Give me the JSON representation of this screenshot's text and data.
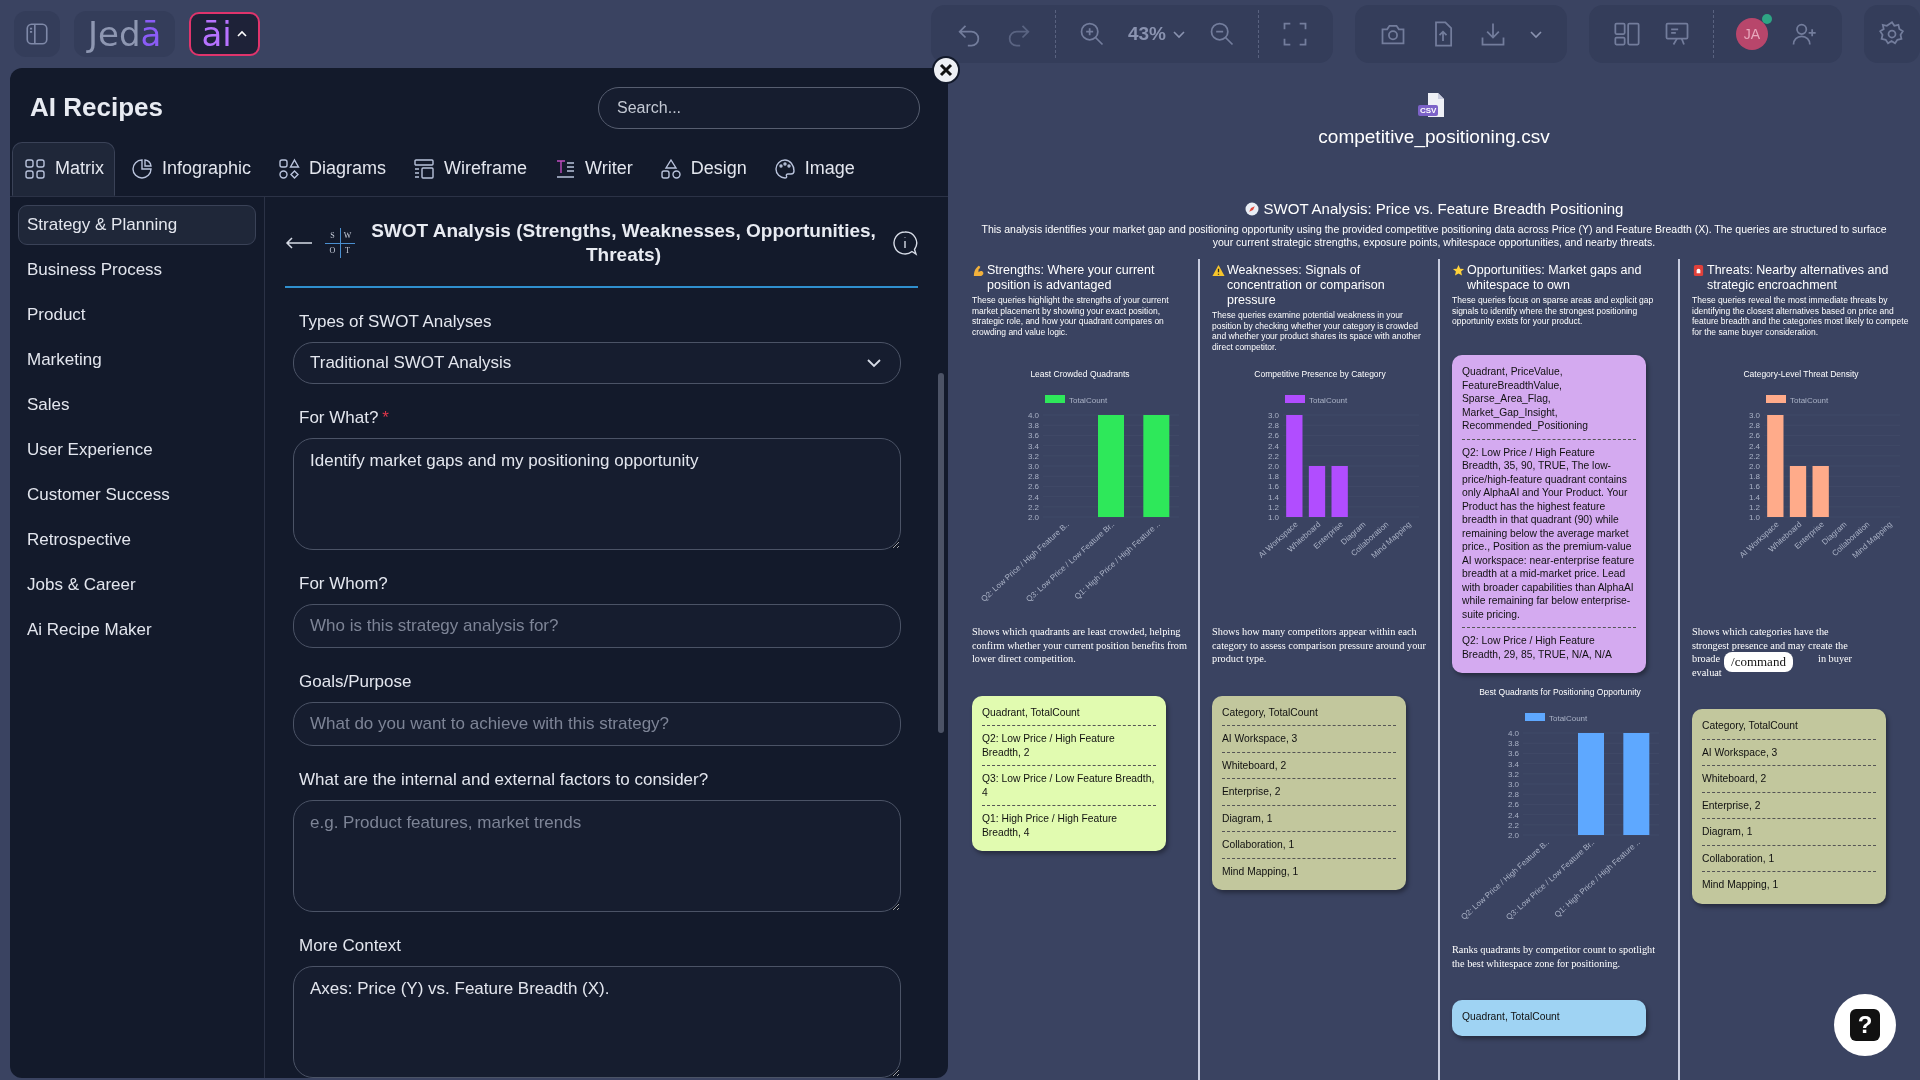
{
  "topbar": {
    "logo": "Jedā",
    "ai_button": {
      "label": "āi",
      "expanded": true
    }
  },
  "recipes_panel": {
    "title": "AI Recipes",
    "search": {
      "placeholder": "Search..."
    },
    "tabs": [
      {
        "label": "Matrix",
        "selected": true
      },
      {
        "label": "Infographic",
        "selected": false
      },
      {
        "label": "Diagrams",
        "selected": false
      },
      {
        "label": "Wireframe",
        "selected": false
      },
      {
        "label": "Writer",
        "selected": false
      },
      {
        "label": "Design",
        "selected": false
      },
      {
        "label": "Image",
        "selected": false
      }
    ],
    "categories": [
      {
        "label": "Strategy & Planning",
        "selected": true
      },
      {
        "label": "Business Process",
        "selected": false
      },
      {
        "label": "Product",
        "selected": false
      },
      {
        "label": "Marketing",
        "selected": false
      },
      {
        "label": "Sales",
        "selected": false
      },
      {
        "label": "User Experience",
        "selected": false
      },
      {
        "label": "Customer Success",
        "selected": false
      },
      {
        "label": "Retrospective",
        "selected": false
      },
      {
        "label": "Jobs & Career",
        "selected": false
      },
      {
        "label": "Ai Recipe Maker",
        "selected": false
      }
    ],
    "required_mark": "*",
    "recipe": {
      "title": "SWOT Analysis (Strengths, Weaknesses, Opportunities, Threats)",
      "icon_letters": [
        "S",
        "W",
        "O",
        "T"
      ]
    },
    "fields": [
      {
        "kind": "select",
        "label": "Types of SWOT Analyses",
        "required": false,
        "value": "Traditional SWOT Analysis"
      },
      {
        "kind": "textarea",
        "label": "For What?",
        "required": true,
        "value": "Identify market gaps and my positioning opportunity"
      },
      {
        "kind": "input",
        "label": "For Whom?",
        "required": false,
        "placeholder": "Who is this strategy analysis for?"
      },
      {
        "kind": "input",
        "label": "Goals/Purpose",
        "required": false,
        "placeholder": "What do you want to achieve with this strategy?"
      },
      {
        "kind": "textarea",
        "label": "What are the internal and external factors to consider?",
        "required": false,
        "placeholder": "e.g. Product features, market trends"
      },
      {
        "kind": "textarea",
        "label": "More Context",
        "required": false,
        "value": "Axes: Price (Y) vs. Feature Breadth (X)."
      }
    ]
  },
  "toolbar": {
    "zoom": "43%",
    "avatar": {
      "initials": "JA",
      "online": true
    }
  },
  "canvas": {
    "file_badge": "CSV",
    "file_name": "competitive_positioning.csv",
    "title": "SWOT Analysis: Price vs. Feature Breadth Positioning",
    "description": "This analysis identifies your market gap and positioning opportunity using the provided competitive positioning data across Price (Y) and Feature Breadth (X). The queries are structured to surface your current strategic strengths, exposure points, whitespace opportunities, and nearby threats.",
    "columns": [
      {
        "kind": "strengths",
        "heading": "Strengths: Where your current position is advantaged",
        "description": "These queries highlight the strengths of your current market placement by showing your exact position, strategic role, and how your quadrant compares on crowding and value logic.",
        "blocks": [
          {
            "kind": "chart",
            "chart_data": {
              "type": "bar",
              "title": "Least Crowded Quadrants",
              "categories": [
                "Q2: Low Price / High Feature B..",
                "Q3: Low Price / Low Feature Br..",
                "Q1: High Price / High Feature .."
              ],
              "series": [
                {
                  "name": "TotalCount",
                  "color": "#2ee85a",
                  "values": [
                    2,
                    4,
                    4
                  ]
                }
              ],
              "ylim": [
                2,
                4
              ],
              "yticks": [
                {
                  "value": 2,
                  "label": "2.0"
                },
                {
                  "value": 2.2,
                  "label": "2.2"
                },
                {
                  "value": 2.4,
                  "label": "2.4"
                },
                {
                  "value": 2.6,
                  "label": "2.6"
                },
                {
                  "value": 2.8,
                  "label": "2.8"
                },
                {
                  "value": 3,
                  "label": "3.0"
                },
                {
                  "value": 3.2,
                  "label": "3.2"
                },
                {
                  "value": 3.4,
                  "label": "3.4"
                },
                {
                  "value": 3.6,
                  "label": "3.6"
                },
                {
                  "value": 3.8,
                  "label": "3.8"
                },
                {
                  "value": 4,
                  "label": "4.0"
                }
              ]
            }
          },
          {
            "kind": "caption",
            "text": "Shows which quadrants are least crowded, helping confirm whether your current position benefits from lower direct competition."
          },
          {
            "kind": "note",
            "color": "#e1fbb0",
            "entries": [
              "Quadrant, TotalCount",
              "Q2: Low Price / High Feature Breadth, 2",
              "Q3: Low Price / Low Feature Breadth, 4",
              "Q1: High Price / High Feature Breadth, 4"
            ]
          }
        ]
      },
      {
        "kind": "weaknesses",
        "heading": "Weaknesses: Signals of concentration or comparison pressure",
        "description": "These queries examine potential weakness in your position by checking whether your category is crowded and whether your product shares its space with another direct competitor.",
        "blocks": [
          {
            "kind": "chart",
            "chart_data": {
              "type": "bar",
              "title": "Competitive Presence by Category",
              "categories": [
                "AI Workspace",
                "Whiteboard",
                "Enterprise",
                "Diagram",
                "Collaboration",
                "Mind Mapping"
              ],
              "series": [
                {
                  "name": "TotalCount",
                  "color": "#b14dff",
                  "values": [
                    3,
                    2,
                    2,
                    1,
                    1,
                    1
                  ]
                }
              ],
              "ylim": [
                1,
                3
              ],
              "yticks": [
                {
                  "value": 1,
                  "label": "1.0"
                },
                {
                  "value": 1.2,
                  "label": "1.2"
                },
                {
                  "value": 1.4,
                  "label": "1.4"
                },
                {
                  "value": 1.6,
                  "label": "1.6"
                },
                {
                  "value": 1.8,
                  "label": "1.8"
                },
                {
                  "value": 2,
                  "label": "2.0"
                },
                {
                  "value": 2.2,
                  "label": "2.2"
                },
                {
                  "value": 2.4,
                  "label": "2.4"
                },
                {
                  "value": 2.6,
                  "label": "2.6"
                },
                {
                  "value": 2.8,
                  "label": "2.8"
                },
                {
                  "value": 3,
                  "label": "3.0"
                }
              ]
            }
          },
          {
            "kind": "caption",
            "text": "Shows how many competitors appear within each category to assess comparison pressure around your product type."
          },
          {
            "kind": "note",
            "color": "#c2c79d",
            "entries": [
              "Category, TotalCount",
              "AI Workspace, 3",
              "Whiteboard, 2",
              "Enterprise, 2",
              "Diagram, 1",
              "Collaboration, 1",
              "Mind Mapping, 1"
            ]
          }
        ]
      },
      {
        "kind": "opportunities",
        "heading": "Opportunities: Market gaps and whitespace to own",
        "description": "These queries focus on sparse areas and explicit gap signals to identify where the strongest positioning opportunity exists for your product.",
        "blocks": [
          {
            "kind": "note",
            "color": "#d4aaf0",
            "entries": [
              "Quadrant, PriceValue, FeatureBreadthValue, Sparse_Area_Flag, Market_Gap_Insight, Recommended_Positioning",
              "Q2: Low Price / High Feature Breadth, 35, 90, TRUE, The low-price/high-feature quadrant contains only AlphaAI and Your Product. Your Product has the highest feature breadth in that quadrant (90) while remaining below the average market price., Position as the premium-value AI workspace: near-enterprise feature breadth at a mid-market price. Lead with broader capabilities than AlphaAI while remaining far below enterprise-suite pricing.",
              "Q2: Low Price / High Feature Breadth, 29, 85, TRUE, N/A, N/A"
            ]
          },
          {
            "kind": "chart",
            "chart_data": {
              "type": "bar",
              "title": "Best Quadrants for Positioning Opportunity",
              "categories": [
                "Q2: Low Price / High Feature B..",
                "Q3: Low Price / Low Feature Br..",
                "Q1: High Price / High Feature .."
              ],
              "series": [
                {
                  "name": "TotalCount",
                  "color": "#5ea8ff",
                  "values": [
                    2,
                    4,
                    4
                  ]
                }
              ],
              "ylim": [
                2,
                4
              ],
              "yticks": [
                {
                  "value": 2,
                  "label": "2.0"
                },
                {
                  "value": 2.2,
                  "label": "2.2"
                },
                {
                  "value": 2.4,
                  "label": "2.4"
                },
                {
                  "value": 2.6,
                  "label": "2.6"
                },
                {
                  "value": 2.8,
                  "label": "2.8"
                },
                {
                  "value": 3,
                  "label": "3.0"
                },
                {
                  "value": 3.2,
                  "label": "3.2"
                },
                {
                  "value": 3.4,
                  "label": "3.4"
                },
                {
                  "value": 3.6,
                  "label": "3.6"
                },
                {
                  "value": 3.8,
                  "label": "3.8"
                },
                {
                  "value": 4,
                  "label": "4.0"
                }
              ]
            }
          },
          {
            "kind": "caption",
            "text": "Ranks quadrants by competitor count to spotlight the best whitespace zone for positioning."
          },
          {
            "kind": "note",
            "color": "#9fd3f3",
            "entries": [
              "Quadrant, TotalCount"
            ]
          }
        ]
      },
      {
        "kind": "threats",
        "heading": "Threats: Nearby alternatives and strategic encroachment",
        "description": "These queries reveal the most immediate threats by identifying the closest alternatives based on price and feature breadth and the categories most likely to compete for the same buyer consideration.",
        "blocks": [
          {
            "kind": "chart",
            "chart_data": {
              "type": "bar",
              "title": "Category-Level Threat Density",
              "categories": [
                "AI Workspace",
                "Whiteboard",
                "Enterprise",
                "Diagram",
                "Collaboration",
                "Mind Mapping"
              ],
              "series": [
                {
                  "name": "TotalCount",
                  "color": "#ffab8a",
                  "values": [
                    3,
                    2,
                    2,
                    1,
                    1,
                    1
                  ]
                }
              ],
              "ylim": [
                1,
                3
              ],
              "yticks": [
                {
                  "value": 1,
                  "label": "1.0"
                },
                {
                  "value": 1.2,
                  "label": "1.2"
                },
                {
                  "value": 1.4,
                  "label": "1.4"
                },
                {
                  "value": 1.6,
                  "label": "1.6"
                },
                {
                  "value": 1.8,
                  "label": "1.8"
                },
                {
                  "value": 2,
                  "label": "2.0"
                },
                {
                  "value": 2.2,
                  "label": "2.2"
                },
                {
                  "value": 2.4,
                  "label": "2.4"
                },
                {
                  "value": 2.6,
                  "label": "2.6"
                },
                {
                  "value": 2.8,
                  "label": "2.8"
                },
                {
                  "value": 3,
                  "label": "3.0"
                }
              ]
            }
          },
          {
            "kind": "covered_caption",
            "lines": [
              "Shows which categories have the",
              "strongest presence and may create the",
              "broade",
              "in buyer",
              "evaluat"
            ]
          },
          {
            "kind": "note",
            "color": "#c2c79d",
            "entries": [
              "Category, TotalCount",
              "AI Workspace, 3",
              "Whiteboard, 2",
              "Enterprise, 2",
              "Diagram, 1",
              "Collaboration, 1",
              "Mind Mapping, 1"
            ]
          }
        ]
      }
    ],
    "command_chip": "/command",
    "help_button": "?"
  }
}
